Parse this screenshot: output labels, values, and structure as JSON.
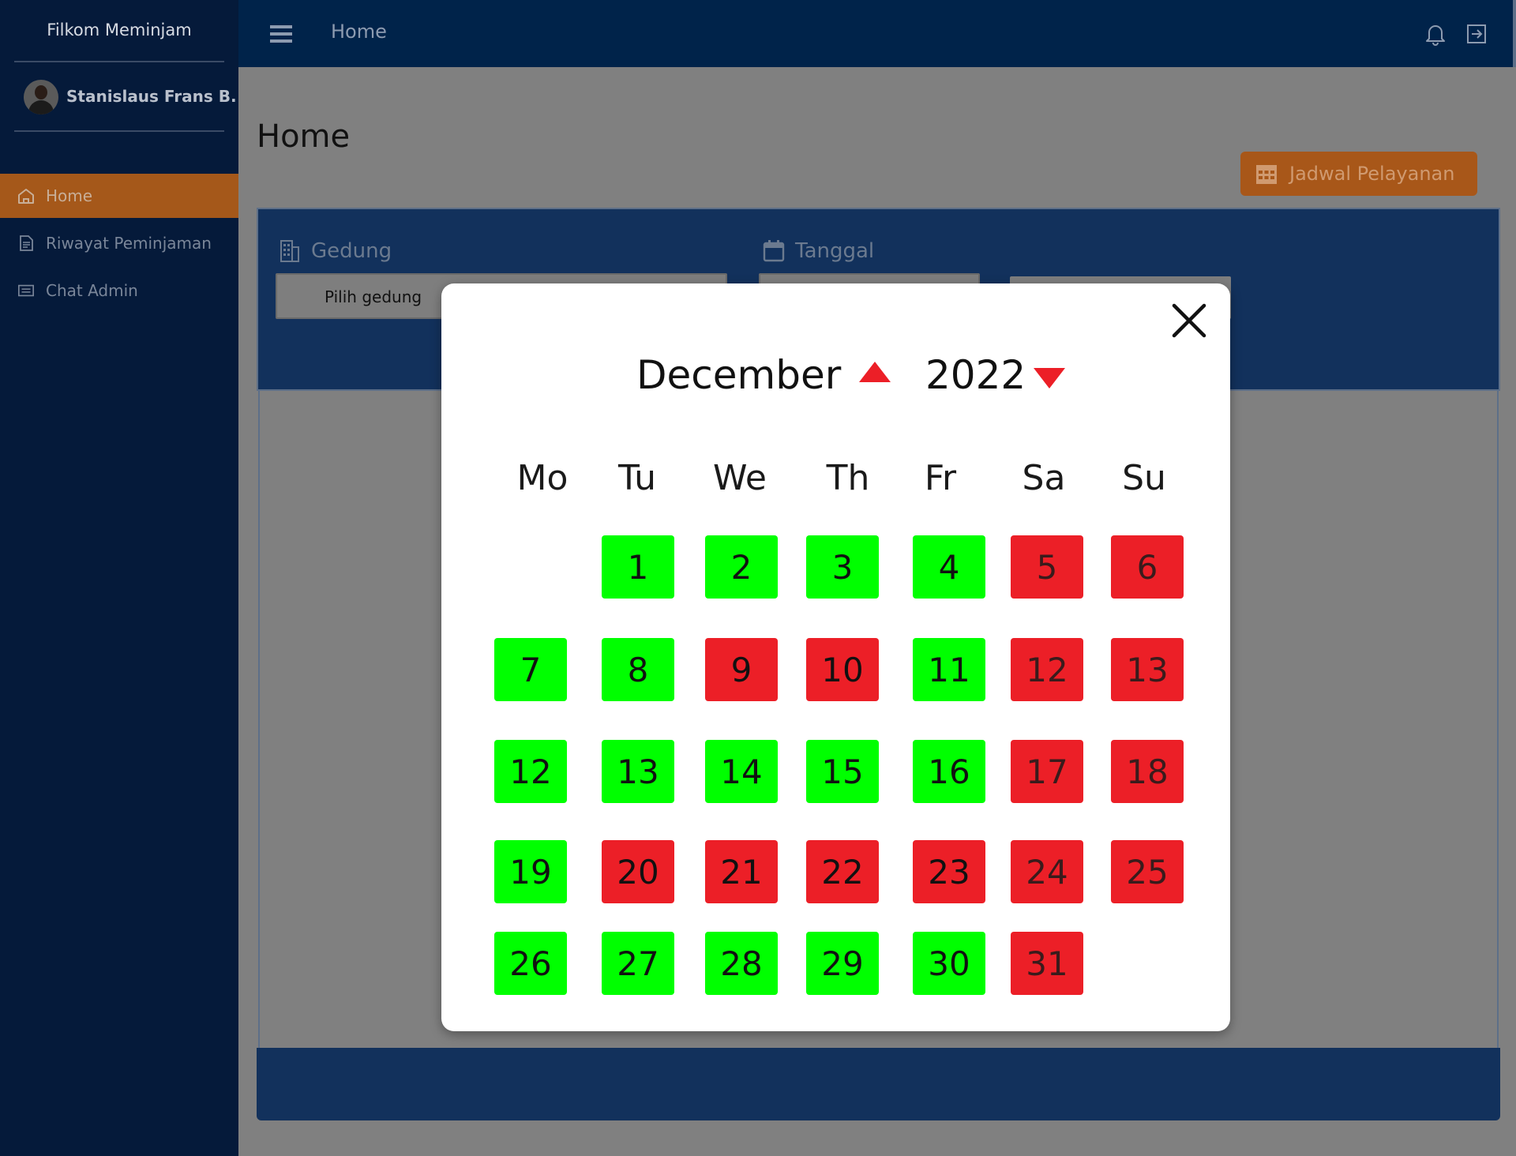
{
  "sidebar": {
    "brand": "Filkom Meminjam",
    "user_name": "Stanislaus Frans B.",
    "items": [
      {
        "label": "Home",
        "icon": "home-icon",
        "active": true
      },
      {
        "label": "Riwayat Peminjaman",
        "icon": "document-icon",
        "active": false
      },
      {
        "label": "Chat Admin",
        "icon": "chat-icon",
        "active": false
      }
    ]
  },
  "topbar": {
    "title": "Home",
    "icons": [
      "menu-icon",
      "bell-icon",
      "logout-icon"
    ]
  },
  "main": {
    "page_title": "Home",
    "schedule_button": "Jadwal Pelayanan",
    "filters": {
      "building_label": "Gedung",
      "building_placeholder": "Pilih gedung",
      "date_label": "Tanggal"
    }
  },
  "calendar": {
    "month": "December",
    "year": "2022",
    "weekdays": [
      "Mo",
      "Tu",
      "We",
      "Th",
      "Fr",
      "Sa",
      "Su"
    ],
    "weeks": [
      [
        null,
        {
          "day": "1",
          "status": "available"
        },
        {
          "day": "2",
          "status": "available"
        },
        {
          "day": "3",
          "status": "available"
        },
        {
          "day": "4",
          "status": "available"
        },
        {
          "day": "5",
          "status": "booked"
        },
        {
          "day": "6",
          "status": "booked"
        }
      ],
      [
        {
          "day": "7",
          "status": "available"
        },
        {
          "day": "8",
          "status": "available"
        },
        {
          "day": "9",
          "status": "booked"
        },
        {
          "day": "10",
          "status": "booked"
        },
        {
          "day": "11",
          "status": "available"
        },
        {
          "day": "12",
          "status": "booked"
        },
        {
          "day": "13",
          "status": "booked"
        }
      ],
      [
        {
          "day": "12",
          "status": "available"
        },
        {
          "day": "13",
          "status": "available"
        },
        {
          "day": "14",
          "status": "available"
        },
        {
          "day": "15",
          "status": "available"
        },
        {
          "day": "16",
          "status": "available"
        },
        {
          "day": "17",
          "status": "booked"
        },
        {
          "day": "18",
          "status": "booked"
        }
      ],
      [
        {
          "day": "19",
          "status": "available"
        },
        {
          "day": "20",
          "status": "booked"
        },
        {
          "day": "21",
          "status": "booked"
        },
        {
          "day": "22",
          "status": "booked"
        },
        {
          "day": "23",
          "status": "booked"
        },
        {
          "day": "24",
          "status": "booked"
        },
        {
          "day": "25",
          "status": "booked"
        }
      ],
      [
        {
          "day": "26",
          "status": "available"
        },
        {
          "day": "27",
          "status": "available"
        },
        {
          "day": "28",
          "status": "available"
        },
        {
          "day": "29",
          "status": "available"
        },
        {
          "day": "30",
          "status": "available"
        },
        {
          "day": "31",
          "status": "booked"
        },
        null
      ]
    ],
    "colors": {
      "available": "#00ff00",
      "booked": "#ec1f27",
      "nav_arrow": "#ec1f27"
    }
  }
}
